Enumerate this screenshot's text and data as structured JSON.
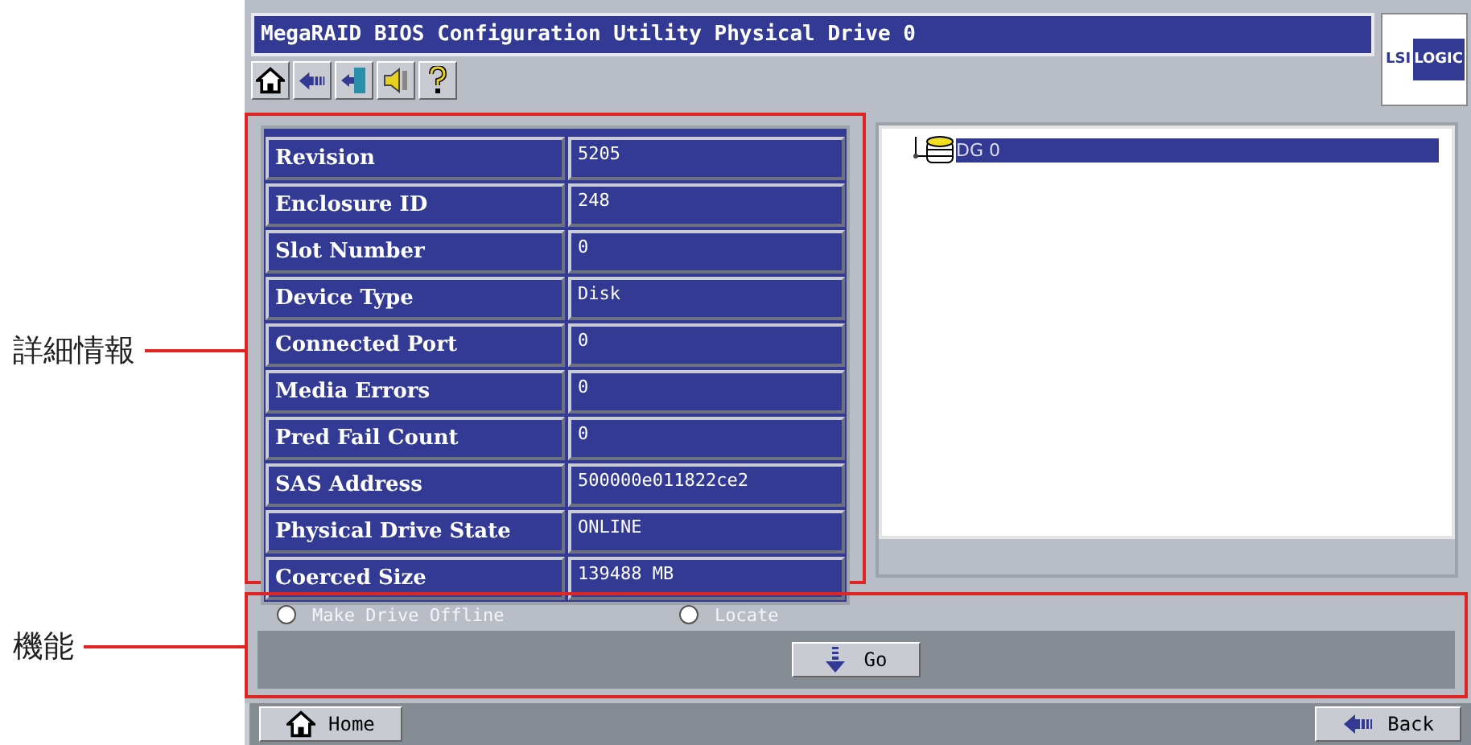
{
  "annotations": [
    {
      "label": "詳細情報"
    },
    {
      "label": "機能"
    }
  ],
  "window": {
    "title": "MegaRAID BIOS Configuration Utility  Physical Drive 0",
    "logo": [
      "LSI",
      "LOGIC"
    ]
  },
  "properties": [
    {
      "label": "Revision",
      "value": "5205"
    },
    {
      "label": "Enclosure ID",
      "value": "248"
    },
    {
      "label": "Slot Number",
      "value": "0"
    },
    {
      "label": "Device Type",
      "value": "Disk"
    },
    {
      "label": "Connected Port",
      "value": "0"
    },
    {
      "label": "Media Errors",
      "value": "0"
    },
    {
      "label": "Pred Fail Count",
      "value": "0"
    },
    {
      "label": "SAS Address",
      "value": "500000e011822ce2"
    },
    {
      "label": "Physical Drive State",
      "value": "ONLINE"
    },
    {
      "label": "Coerced Size",
      "value": "139488 MB"
    }
  ],
  "tree": {
    "items": [
      {
        "label": "DG 0",
        "selected": true
      }
    ]
  },
  "operations": [
    {
      "label": "Make Drive Offline",
      "selected": false
    },
    {
      "label": "Locate",
      "selected": false
    }
  ],
  "go_button": "Go",
  "footer": {
    "home": "Home",
    "back": "Back"
  }
}
